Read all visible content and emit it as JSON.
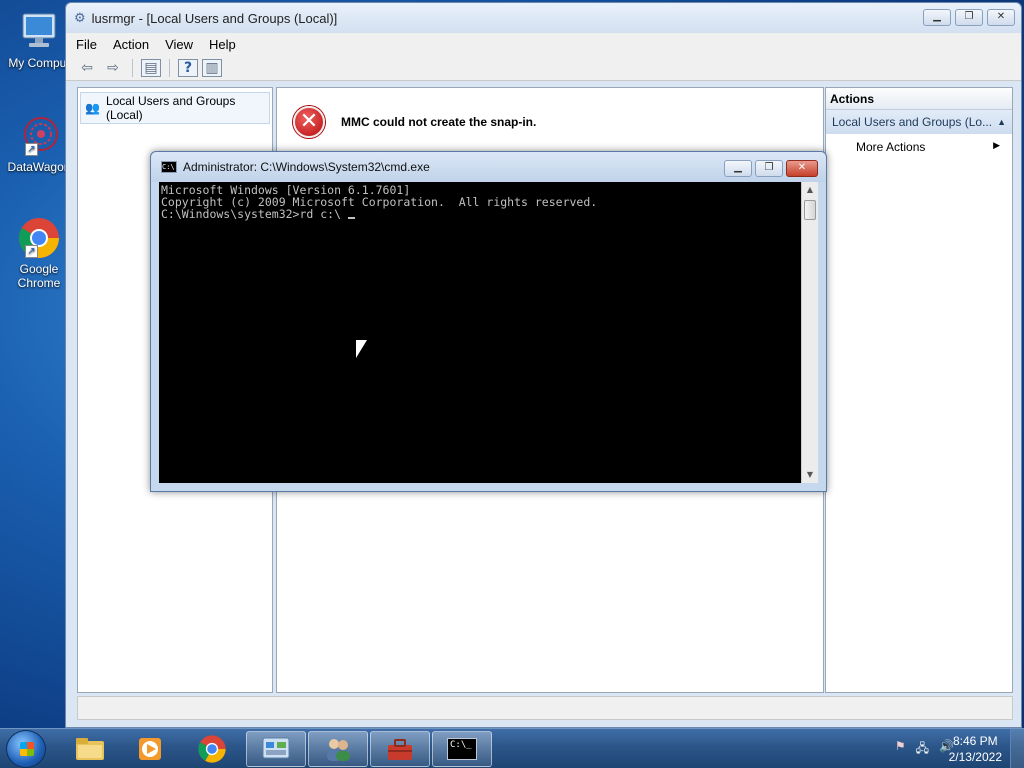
{
  "desktop": {
    "icons": [
      {
        "label": "My Comput"
      },
      {
        "label": "DataWagon"
      },
      {
        "label": "Google Chrome"
      }
    ]
  },
  "mmc": {
    "title": "lusrmgr - [Local Users and Groups (Local)]",
    "menu": [
      "File",
      "Action",
      "View",
      "Help"
    ],
    "tree": {
      "root_label": "Local Users and Groups (Local)"
    },
    "error_message": "MMC could not create the snap-in.",
    "actions": {
      "header": "Actions",
      "selected": "Local Users and Groups (Lo...",
      "more": "More Actions"
    }
  },
  "cmd": {
    "title": "Administrator: C:\\Windows\\System32\\cmd.exe",
    "lines": [
      "Microsoft Windows [Version 6.1.7601]",
      "Copyright (c) 2009 Microsoft Corporation.  All rights reserved.",
      "",
      "C:\\Windows\\system32>rd c:\\ "
    ]
  },
  "taskbar": {
    "time": "8:46 PM",
    "date": "2/13/2022"
  }
}
